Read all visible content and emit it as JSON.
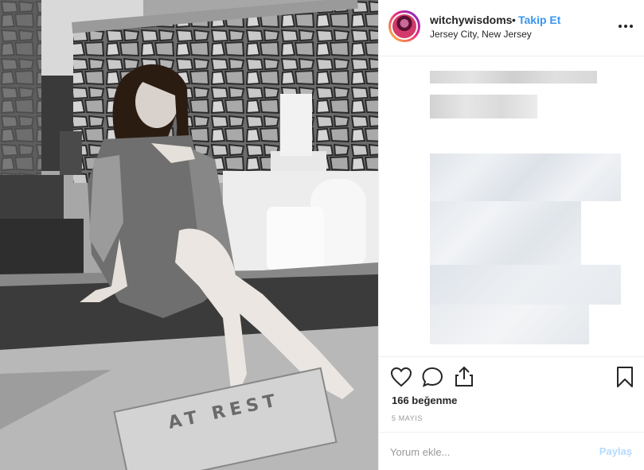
{
  "post": {
    "username": "witchywisdoms",
    "separator": "•",
    "follow_label": "Takip Et",
    "location": "Jersey City, New Jersey",
    "likes": "166 beğenme",
    "date": "5 MAYIS",
    "photo_text": "AT REST"
  },
  "comment": {
    "placeholder": "Yorum ekle...",
    "post_label": "Paylaş"
  },
  "icons": {
    "more": "more-options-icon",
    "like": "heart-icon",
    "comment": "comment-bubble-icon",
    "share": "share-icon",
    "save": "bookmark-icon"
  },
  "colors": {
    "accent": "#3897f0",
    "post_button_disabled": "#b3dbff",
    "text": "#262626",
    "muted": "#999999"
  }
}
